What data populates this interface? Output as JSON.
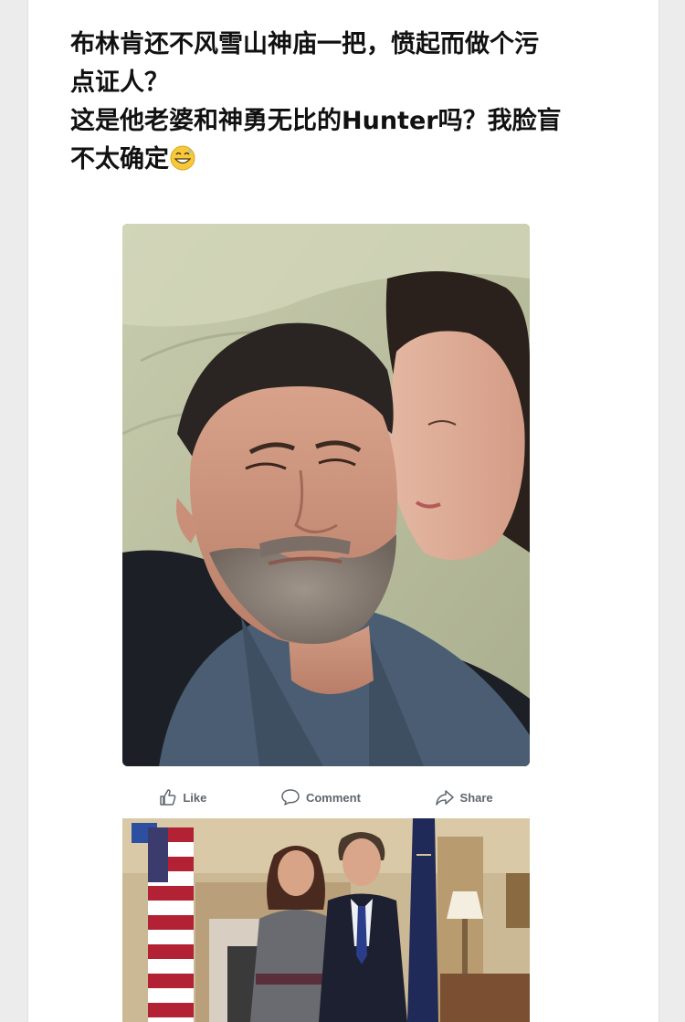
{
  "post": {
    "text_lines": [
      "布林肯还不风雪山神庙一把，愤起而做个污",
      "点证人？",
      "这是他老婆和神勇无比的Hunter吗？我脸盲",
      "不太确定"
    ],
    "emoji_icon": "grinning-sweat-emoji"
  },
  "actions": {
    "like_label": "Like",
    "comment_label": "Comment",
    "share_label": "Share"
  },
  "colors": {
    "background": "#ececec",
    "card": "#ffffff",
    "text": "#111111",
    "action_text": "#606770"
  }
}
